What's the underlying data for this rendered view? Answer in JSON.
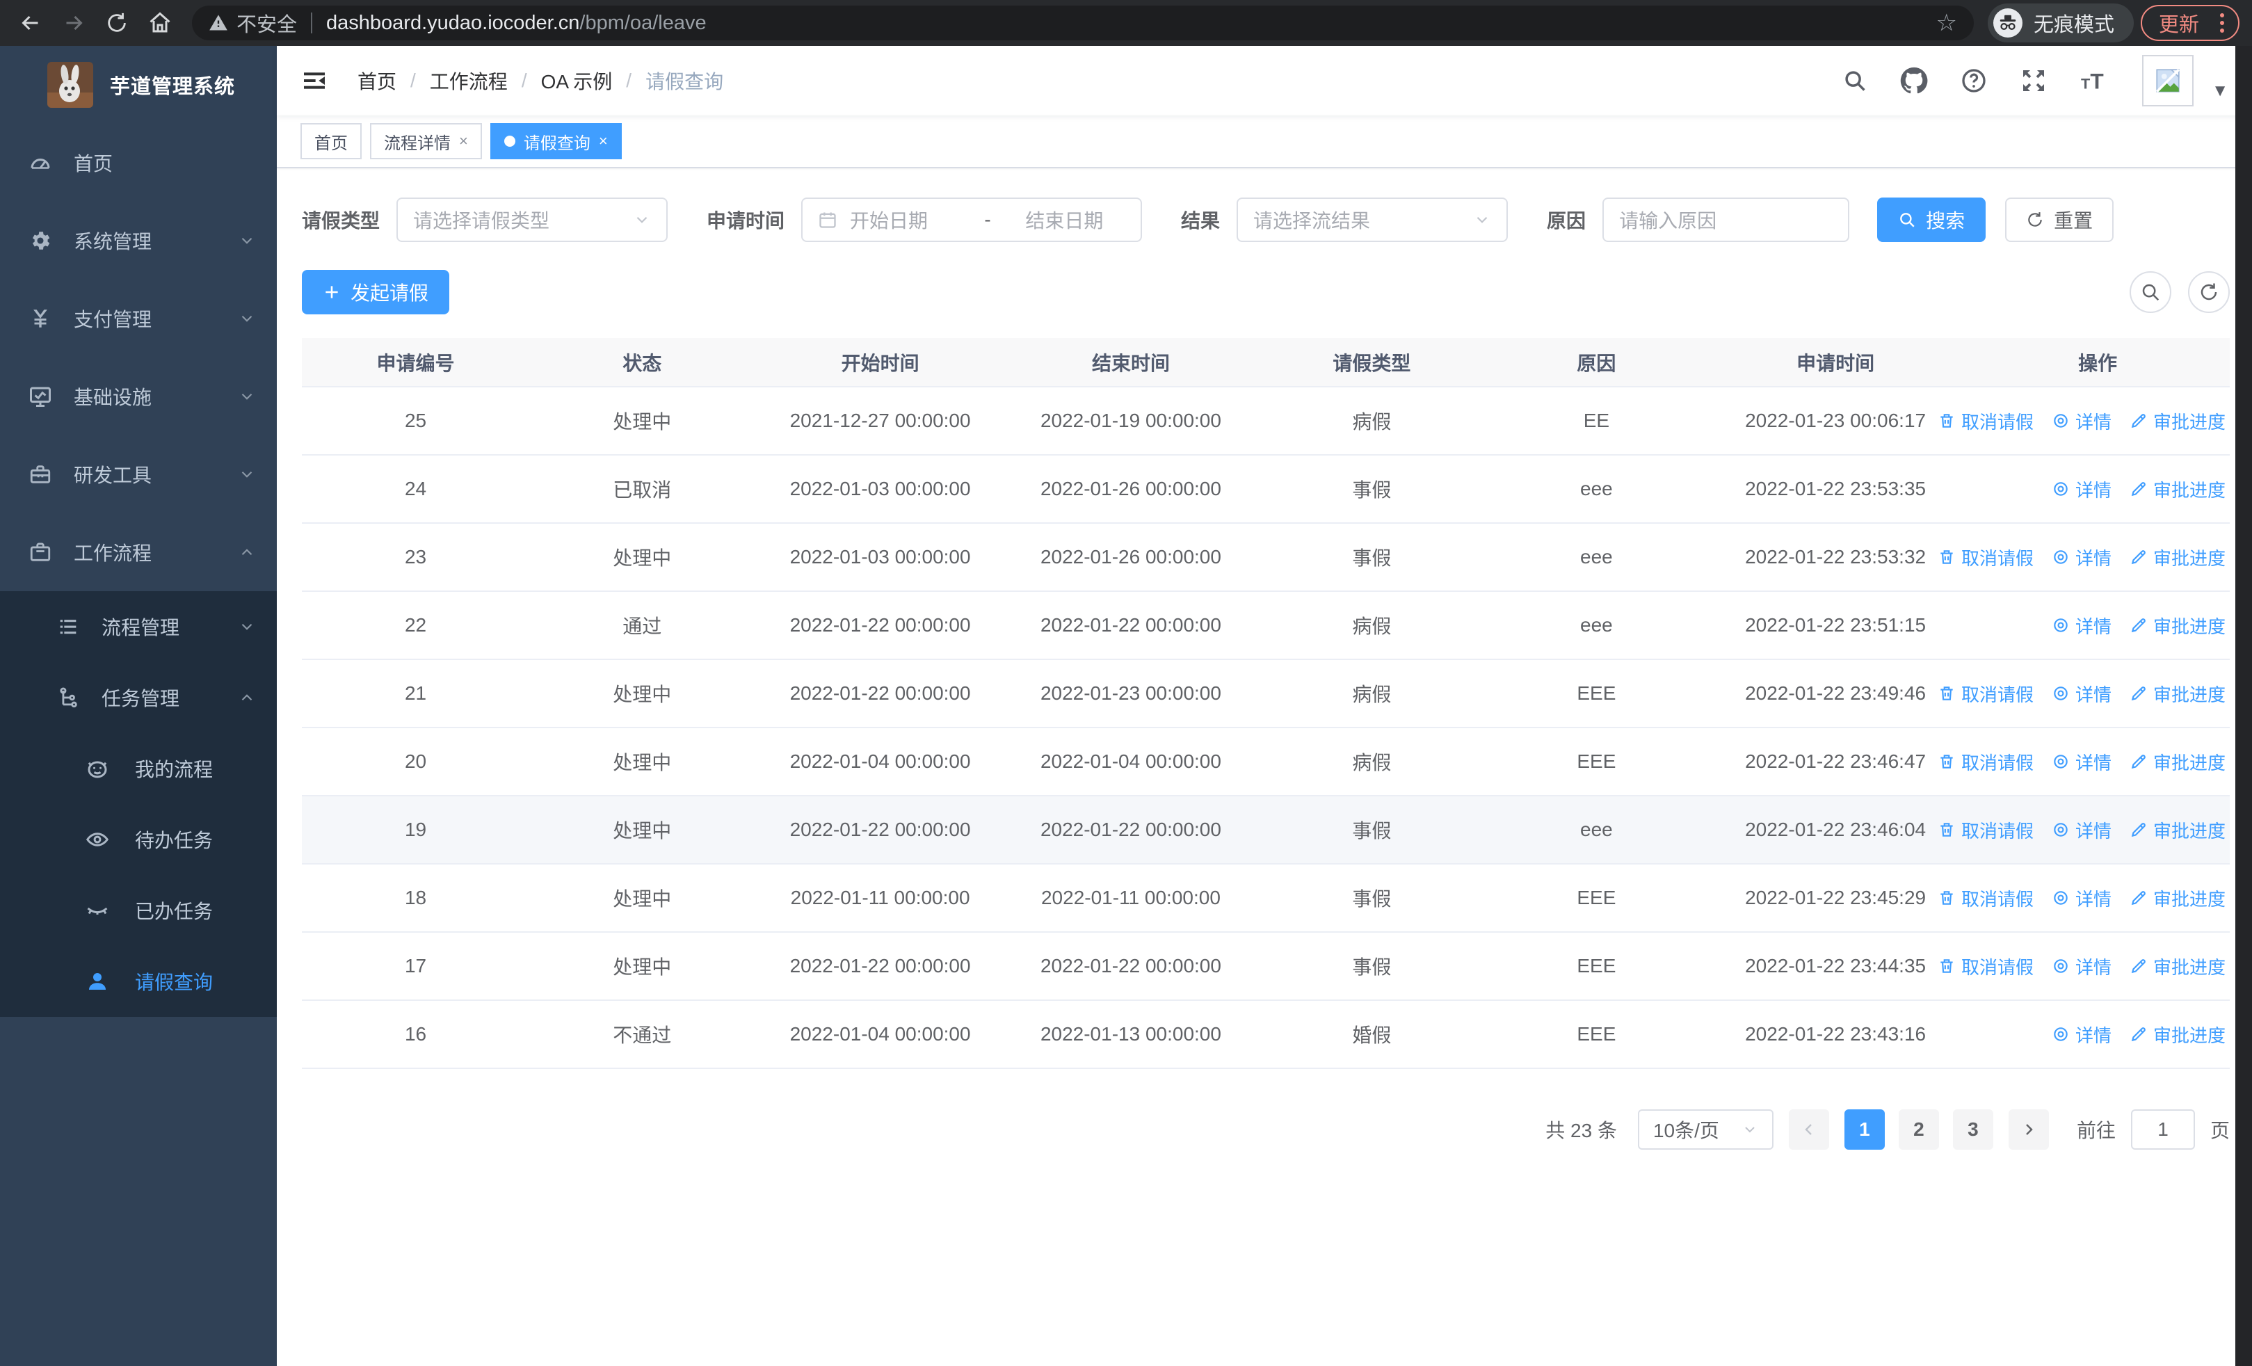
{
  "colors": {
    "primary": "#409eff",
    "sidebar_bg": "#304156",
    "submenu_bg": "#1f2d3d",
    "update_accent": "#f28b82",
    "table_border": "#ebeef5",
    "highlight_row": "#f5f7fa"
  },
  "browser": {
    "security_label": "不安全",
    "url_host": "dashboard.yudao.iocoder.cn",
    "url_path": "/bpm/oa/leave",
    "incognito_label": "无痕模式",
    "update_label": "更新",
    "nav_icons": [
      "back-icon",
      "forward-icon",
      "reload-icon",
      "home-icon",
      "star-icon",
      "menu-dots-icon"
    ]
  },
  "sidebar": {
    "title": "芋道管理系统",
    "items": [
      {
        "label": "首页",
        "icon": "dashboard-icon",
        "arrow": ""
      },
      {
        "label": "系统管理",
        "icon": "gear-icon",
        "arrow": "down"
      },
      {
        "label": "支付管理",
        "icon": "yen-icon",
        "arrow": "down"
      },
      {
        "label": "基础设施",
        "icon": "monitor-icon",
        "arrow": "down"
      },
      {
        "label": "研发工具",
        "icon": "toolbox-icon",
        "arrow": "down"
      },
      {
        "label": "工作流程",
        "icon": "briefcase-icon",
        "arrow": "up"
      }
    ],
    "submenu": [
      {
        "label": "流程管理",
        "icon": "list-icon",
        "arrow": "down",
        "level": 2,
        "active": false
      },
      {
        "label": "任务管理",
        "icon": "flow-icon",
        "arrow": "up",
        "level": 2,
        "active": false
      },
      {
        "label": "我的流程",
        "icon": "robot-icon",
        "arrow": "",
        "level": 3,
        "active": false
      },
      {
        "label": "待办任务",
        "icon": "eye-open-icon",
        "arrow": "",
        "level": 3,
        "active": false
      },
      {
        "label": "已办任务",
        "icon": "eye-closed-icon",
        "arrow": "",
        "level": 3,
        "active": false
      },
      {
        "label": "请假查询",
        "icon": "user-icon",
        "arrow": "",
        "level": 3,
        "active": true
      }
    ]
  },
  "navbar": {
    "breadcrumb": [
      "首页",
      "工作流程",
      "OA 示例",
      "请假查询"
    ],
    "icons": [
      "search-icon",
      "github-icon",
      "help-icon",
      "fullscreen-icon",
      "font-size-icon"
    ]
  },
  "tabs": [
    {
      "label": "首页",
      "closable": false,
      "active": false
    },
    {
      "label": "流程详情",
      "closable": true,
      "active": false
    },
    {
      "label": "请假查询",
      "closable": true,
      "active": true
    }
  ],
  "filters": {
    "leave_type_label": "请假类型",
    "leave_type_placeholder": "请选择请假类型",
    "apply_time_label": "申请时间",
    "start_placeholder": "开始日期",
    "range_separator": "-",
    "end_placeholder": "结束日期",
    "result_label": "结果",
    "result_placeholder": "请选择流结果",
    "reason_label": "原因",
    "reason_placeholder": "请输入原因",
    "search_label": "搜索",
    "reset_label": "重置"
  },
  "toolbar": {
    "create_label": "发起请假"
  },
  "table": {
    "headers": [
      "申请编号",
      "状态",
      "开始时间",
      "结束时间",
      "请假类型",
      "原因",
      "申请时间",
      "操作"
    ],
    "action_labels": {
      "cancel": "取消请假",
      "detail": "详情",
      "progress": "审批进度"
    },
    "action_icons": {
      "cancel": "trash-icon",
      "detail": "view-icon",
      "progress": "edit-icon"
    },
    "rows": [
      {
        "id": "25",
        "status": "处理中",
        "start": "2021-12-27 00:00:00",
        "end": "2022-01-19 00:00:00",
        "type": "病假",
        "reason": "EE",
        "apply": "2022-01-23 00:06:17",
        "actions": [
          "cancel",
          "detail",
          "progress"
        ],
        "highlight": false
      },
      {
        "id": "24",
        "status": "已取消",
        "start": "2022-01-03 00:00:00",
        "end": "2022-01-26 00:00:00",
        "type": "事假",
        "reason": "eee",
        "apply": "2022-01-22 23:53:35",
        "actions": [
          "detail",
          "progress"
        ],
        "highlight": false
      },
      {
        "id": "23",
        "status": "处理中",
        "start": "2022-01-03 00:00:00",
        "end": "2022-01-26 00:00:00",
        "type": "事假",
        "reason": "eee",
        "apply": "2022-01-22 23:53:32",
        "actions": [
          "cancel",
          "detail",
          "progress"
        ],
        "highlight": false
      },
      {
        "id": "22",
        "status": "通过",
        "start": "2022-01-22 00:00:00",
        "end": "2022-01-22 00:00:00",
        "type": "病假",
        "reason": "eee",
        "apply": "2022-01-22 23:51:15",
        "actions": [
          "detail",
          "progress"
        ],
        "highlight": false
      },
      {
        "id": "21",
        "status": "处理中",
        "start": "2022-01-22 00:00:00",
        "end": "2022-01-23 00:00:00",
        "type": "病假",
        "reason": "EEE",
        "apply": "2022-01-22 23:49:46",
        "actions": [
          "cancel",
          "detail",
          "progress"
        ],
        "highlight": false
      },
      {
        "id": "20",
        "status": "处理中",
        "start": "2022-01-04 00:00:00",
        "end": "2022-01-04 00:00:00",
        "type": "病假",
        "reason": "EEE",
        "apply": "2022-01-22 23:46:47",
        "actions": [
          "cancel",
          "detail",
          "progress"
        ],
        "highlight": false
      },
      {
        "id": "19",
        "status": "处理中",
        "start": "2022-01-22 00:00:00",
        "end": "2022-01-22 00:00:00",
        "type": "事假",
        "reason": "eee",
        "apply": "2022-01-22 23:46:04",
        "actions": [
          "cancel",
          "detail",
          "progress"
        ],
        "highlight": true
      },
      {
        "id": "18",
        "status": "处理中",
        "start": "2022-01-11 00:00:00",
        "end": "2022-01-11 00:00:00",
        "type": "事假",
        "reason": "EEE",
        "apply": "2022-01-22 23:45:29",
        "actions": [
          "cancel",
          "detail",
          "progress"
        ],
        "highlight": false
      },
      {
        "id": "17",
        "status": "处理中",
        "start": "2022-01-22 00:00:00",
        "end": "2022-01-22 00:00:00",
        "type": "事假",
        "reason": "EEE",
        "apply": "2022-01-22 23:44:35",
        "actions": [
          "cancel",
          "detail",
          "progress"
        ],
        "highlight": false
      },
      {
        "id": "16",
        "status": "不通过",
        "start": "2022-01-04 00:00:00",
        "end": "2022-01-13 00:00:00",
        "type": "婚假",
        "reason": "EEE",
        "apply": "2022-01-22 23:43:16",
        "actions": [
          "detail",
          "progress"
        ],
        "highlight": false
      }
    ]
  },
  "pagination": {
    "total_label": "共 23 条",
    "page_size": "10条/页",
    "pages": [
      "1",
      "2",
      "3"
    ],
    "current": "1",
    "goto_label": "前往",
    "goto_value": "1",
    "page_unit": "页"
  }
}
